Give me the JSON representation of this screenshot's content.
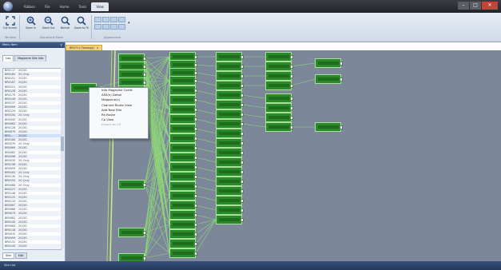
{
  "menu": {
    "tabs": [
      {
        "label": "Ribbon",
        "active": false
      },
      {
        "label": "File",
        "active": false
      },
      {
        "label": "Home",
        "active": false
      },
      {
        "label": "Tools",
        "active": false
      },
      {
        "label": "View",
        "active": true
      }
    ]
  },
  "ribbon": {
    "buttons": [
      {
        "label": "Full Screen",
        "icon": "full-screen-icon"
      },
      {
        "label": "Zoom In",
        "icon": "zoom-in-icon"
      },
      {
        "label": "Zoom Out",
        "icon": "zoom-out-icon"
      },
      {
        "label": "Normal",
        "icon": "zoom-normal-icon"
      },
      {
        "label": "Zoom to Fit",
        "icon": "zoom-fit-icon"
      }
    ],
    "groups": [
      "Window",
      "Document Zoom",
      "Appearance"
    ]
  },
  "left_panel": {
    "title": "Menu Item",
    "tabs": [
      "List",
      "Magazine Site Info"
    ],
    "rows": [
      [
        "BR0117",
        "2G/3G"
      ],
      [
        "BR0165",
        "2G Only"
      ],
      [
        "BR0151",
        "2G/3G"
      ],
      [
        "BR0167",
        "2G/3G"
      ],
      [
        "BR0101",
        "2G/3G"
      ],
      [
        "BR0128",
        "2G/3G"
      ],
      [
        "BR0175",
        "2G/3G"
      ],
      [
        "BR0149",
        "2G/3G"
      ],
      [
        "BR0137",
        "2G/3G"
      ],
      [
        "BR0099",
        "2G/3G"
      ],
      [
        "BR0129",
        "2G/3G"
      ],
      [
        "BR0150",
        "2G Only"
      ],
      [
        "BR0045",
        "2G/3G"
      ],
      [
        "BR0062",
        "2G/3G"
      ],
      [
        "BR0128",
        "2G/3G"
      ],
      [
        "BR0079",
        "2G/3G"
      ],
      [
        "BR3...",
        "2G/3G"
      ],
      [
        "BR0160",
        "2G/3G"
      ],
      [
        "BR0079",
        "2G Only"
      ],
      [
        "BR0069",
        "2G/3G"
      ],
      [
        "BR0082",
        "2G/3G"
      ],
      [
        "BR0096",
        "2G/3G"
      ],
      [
        "BR0035",
        "2G Only"
      ],
      [
        "BR0136",
        "2G/3G"
      ],
      [
        "BR0095",
        "2G/3G"
      ],
      [
        "BR0181",
        "2G Only"
      ],
      [
        "BR0130",
        "2G Only"
      ],
      [
        "BR0155",
        "2G Only"
      ],
      [
        "BR0068",
        "2G Only"
      ],
      [
        "BR0127",
        "2G/3G"
      ],
      [
        "BR0146",
        "2G/3G"
      ],
      [
        "BR0122",
        "2G/3G"
      ],
      [
        "BR0115",
        "2G/3G"
      ],
      [
        "BR0087",
        "2G/3G"
      ],
      [
        "BR0068",
        "2G/3G"
      ],
      [
        "BR0073",
        "2G/3G"
      ],
      [
        "BR0081",
        "2G/3G"
      ],
      [
        "BR0145",
        "2G/3G"
      ],
      [
        "BR0064",
        "2G/3G"
      ],
      [
        "BR0118",
        "2G/3G"
      ],
      [
        "BR0015",
        "2G/3G"
      ],
      [
        "BR0099",
        "2G/3G"
      ],
      [
        "BR0131",
        "2G/3G"
      ],
      [
        "BR0145",
        "2G/3G"
      ]
    ],
    "selected_row": 16,
    "bottom_tabs": [
      "Site",
      "Edit"
    ]
  },
  "document": {
    "tab_label": "BR0714 (Topology)",
    "close_glyph": "x"
  },
  "context_menu": {
    "items": [
      {
        "label": "Info Magazine Cards",
        "enabled": true
      },
      {
        "label": "ASS(e) Detail",
        "enabled": true
      },
      {
        "label": "Magazine(s)",
        "enabled": true
      },
      {
        "label": "Channel Route View",
        "enabled": true
      },
      {
        "label": "Add New Site",
        "enabled": true
      },
      {
        "label": "Re-Route",
        "enabled": true
      },
      {
        "label": "Cp View",
        "enabled": true
      },
      {
        "label": "Export as CP",
        "enabled": false
      }
    ]
  },
  "status": {
    "text": "Site List"
  },
  "colors": {
    "node_fill": "#2a8a2a",
    "link_stroke": "#8fd67a",
    "canvas_bg": "#7c8899"
  }
}
